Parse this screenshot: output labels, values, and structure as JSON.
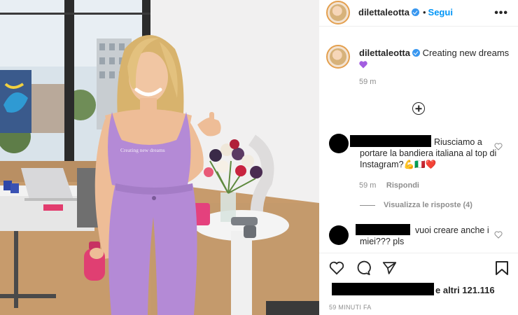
{
  "post": {
    "username": "dilettaleotta",
    "follow_label": "Segui",
    "header_separator": "•",
    "more_icon": "•••",
    "caption_text": "Creating new dreams",
    "caption_time": "59 m",
    "shirt_print": "Creating new dreams"
  },
  "comments": [
    {
      "text": "Riusciamo a portare la bandiera italiana al top di Instagram?💪🇮🇹❤️",
      "time": "59 m",
      "reply_label": "Rispondi",
      "view_replies_label": "Visualizza le risposte (4)"
    },
    {
      "text": "vuoi creare anche i miei??? pls"
    }
  ],
  "footer": {
    "likes_text": "e altri 121.116",
    "timestamp": "59 MINUTI FA"
  },
  "colors": {
    "link": "#0095f6",
    "muted": "#8e8e8e",
    "outfit": "#b48ad6"
  }
}
